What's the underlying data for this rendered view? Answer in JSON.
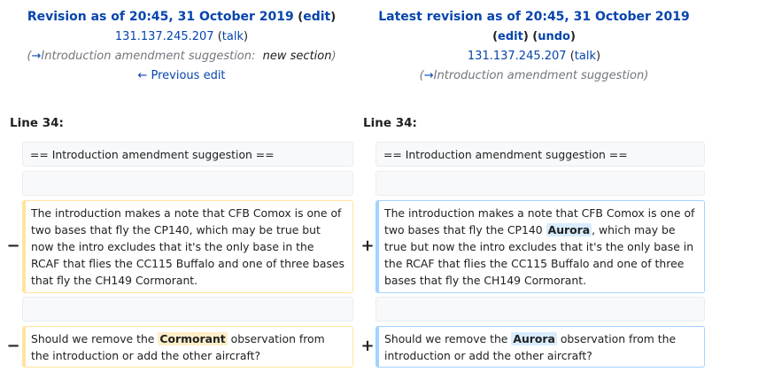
{
  "left_header": {
    "title": "Revision as of 20:45, 31 October 2019",
    "edit_open": " (",
    "edit_label": "edit",
    "edit_close": ")",
    "user": "131.137.245.207",
    "talk_open": " (",
    "talk_label": "talk",
    "talk_close": ")",
    "summary_prefix": "(",
    "summary_arrow": "→",
    "summary_text": "Introduction amendment suggestion:",
    "summary_section": "new section",
    "summary_suffix": ")",
    "prev_edit": "← Previous edit"
  },
  "right_header": {
    "title": "Latest revision as of 20:45, 31 October 2019",
    "edit_label": "edit",
    "undo_label": "undo",
    "user": "131.137.245.207",
    "talk_label": "talk",
    "summary_prefix": "(",
    "summary_arrow": "→",
    "summary_text": "Introduction amendment suggestion",
    "summary_suffix": ")"
  },
  "line_label_left": "Line 34:",
  "line_label_right": "Line 34:",
  "markers": {
    "minus": "−",
    "plus": "+"
  },
  "context_line": "== Introduction amendment suggestion ==",
  "left_para1": "The introduction makes a note that CFB Comox is one of two bases that fly the CP140, which may be true but now the intro excludes that it's the only base in the RCAF that flies the CC115 Buffalo and one of three bases that fly the CH149 Cormorant.",
  "right_para1": {
    "before": "The introduction makes a note that CFB Comox is one of two bases that fly the CP140 ",
    "highlight": "Aurora",
    "after": ", which may be true but now the intro excludes that it's the only base in the RCAF that flies the CC115 Buffalo and one of three bases that fly the CH149 Cormorant."
  },
  "left_para2": {
    "before": "Should we remove the ",
    "highlight": "Cormorant",
    "after": " observation from the introduction or add the other aircraft?"
  },
  "right_para2": {
    "before": "Should we remove the ",
    "highlight": "Aurora",
    "after": " observation from the introduction or add the other aircraft?"
  },
  "colors": {
    "link": "#0645ad",
    "deleted_border": "#ffe49c",
    "added_border": "#a3d3ff",
    "deleted_highlight": "#feeec8",
    "added_highlight": "#d8ecff",
    "context_bg": "#f8f9fa"
  }
}
